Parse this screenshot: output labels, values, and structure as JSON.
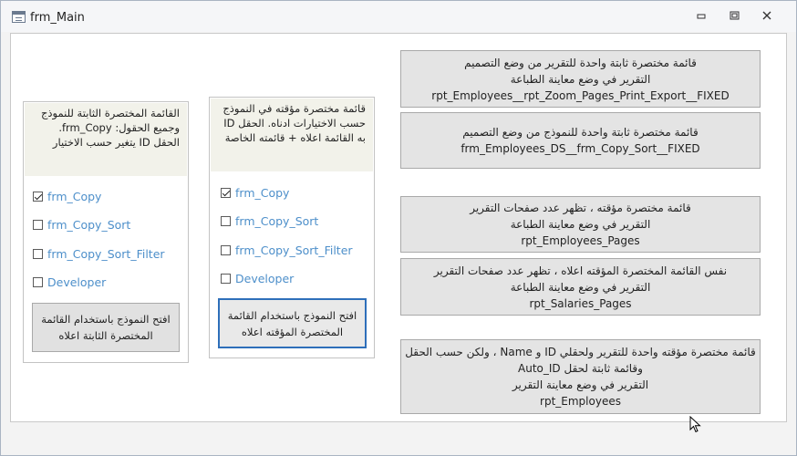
{
  "window": {
    "title": "frm_Main"
  },
  "panel_fixed": {
    "caption": "القائمة المختصرة الثابتة للنموذج وجميع الحقول: frm_Copy. الحقل ID يتغير حسب الاختيار",
    "options": [
      {
        "label": "frm_Copy",
        "checked": true
      },
      {
        "label": "frm_Copy_Sort",
        "checked": false
      },
      {
        "label": "frm_Copy_Sort_Filter",
        "checked": false
      },
      {
        "label": "Developer",
        "checked": false
      }
    ],
    "button": "افتح النموذج باستخدام القائمة المختصرة الثابتة اعلاه"
  },
  "panel_temp": {
    "caption": "قائمة مختصرة مؤقته في النموذج حسب  الاختيارات ادناه. الحقل ID به القائمة اعلاه + قائمته الخاصة",
    "options": [
      {
        "label": "frm_Copy",
        "checked": true
      },
      {
        "label": "frm_Copy_Sort",
        "checked": false
      },
      {
        "label": "frm_Copy_Sort_Filter",
        "checked": false
      },
      {
        "label": "Developer",
        "checked": false
      }
    ],
    "button": "افتح النموذج باستخدام القائمة المختصرة المؤقته اعلاه"
  },
  "right_buttons": [
    {
      "line1": "قائمة مختصرة ثابتة واحدة للتقرير من وضع التصميم",
      "line2": "التقرير في وضع معاينة الطباعة",
      "line3": "rpt_Employees__rpt_Zoom_Pages_Print_Export__FIXED"
    },
    {
      "line1": "قائمة مختصرة ثابتة واحدة للنموذج من وضع التصميم",
      "line2": "frm_Employees_DS__frm_Copy_Sort__FIXED"
    },
    {
      "line1": "قائمة مختصرة مؤقته ، تظهر عدد صفحات التقرير",
      "line2": "التقرير في وضع معاينة الطباعة",
      "line3": "rpt_Employees_Pages"
    },
    {
      "line1": "نفس القائمة المختصرة المؤقته اعلاه ، تظهر عدد صفحات التقرير",
      "line2": "التقرير في وضع معاينة الطباعة",
      "line3": "rpt_Salaries_Pages"
    },
    {
      "line1": "قائمة مختصرة مؤقته واحدة للتقرير ولحقلي ID و Name ، ولكن حسب الحقل",
      "line2": "وقائمة ثابتة لحقل Auto_ID",
      "line3": "التقرير في وضع معاينة التقرير",
      "line4": "rpt_Employees"
    }
  ]
}
